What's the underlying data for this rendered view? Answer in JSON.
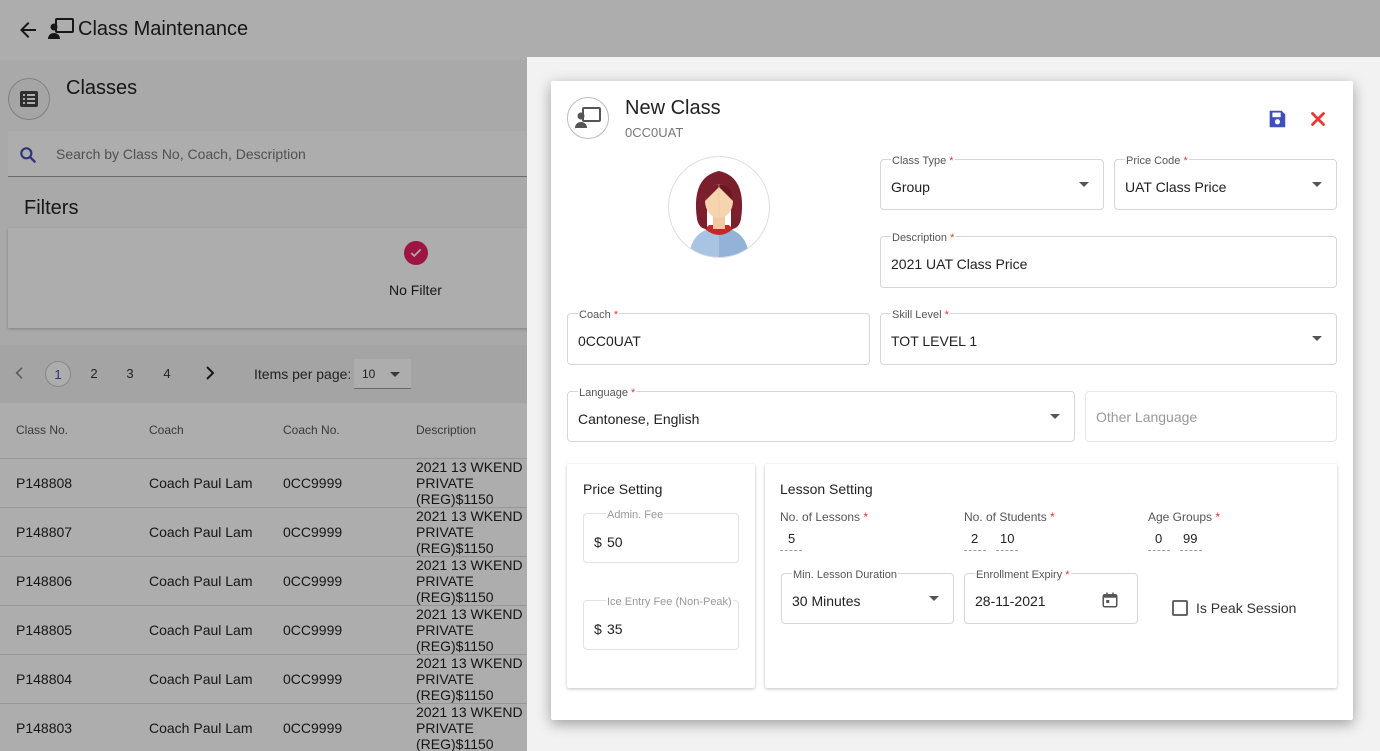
{
  "app": {
    "title": "Class Maintenance"
  },
  "list": {
    "section_title": "Classes",
    "search_placeholder": "Search by Class No, Coach, Description",
    "filters_title": "Filters",
    "filter_option": "No Filter",
    "pages": [
      "1",
      "2",
      "3",
      "4"
    ],
    "active_page": "1",
    "items_per_page_label": "Items per page:",
    "items_per_page": "10",
    "columns": [
      "Class No.",
      "Coach",
      "Coach No.",
      "Description"
    ],
    "rows": [
      {
        "class_no": "P148808",
        "coach": "Coach Paul Lam",
        "coach_no": "0CC9999",
        "desc1": "2021 13 WKEND",
        "desc2": "PRIVATE",
        "desc3": "(REG)$1150"
      },
      {
        "class_no": "P148807",
        "coach": "Coach Paul Lam",
        "coach_no": "0CC9999",
        "desc1": "2021 13 WKEND",
        "desc2": "PRIVATE",
        "desc3": "(REG)$1150"
      },
      {
        "class_no": "P148806",
        "coach": "Coach Paul Lam",
        "coach_no": "0CC9999",
        "desc1": "2021 13 WKEND",
        "desc2": "PRIVATE",
        "desc3": "(REG)$1150"
      },
      {
        "class_no": "P148805",
        "coach": "Coach Paul Lam",
        "coach_no": "0CC9999",
        "desc1": "2021 13 WKEND",
        "desc2": "PRIVATE",
        "desc3": "(REG)$1150"
      },
      {
        "class_no": "P148804",
        "coach": "Coach Paul Lam",
        "coach_no": "0CC9999",
        "desc1": "2021 13 WKEND",
        "desc2": "PRIVATE",
        "desc3": "(REG)$1150"
      },
      {
        "class_no": "P148803",
        "coach": "Coach Paul Lam",
        "coach_no": "0CC9999",
        "desc1": "2021 13 WKEND",
        "desc2": "PRIVATE",
        "desc3": "(REG)$1150"
      }
    ]
  },
  "dialog": {
    "title": "New Class",
    "subtitle": "0CC0UAT",
    "class_type": {
      "label": "Class Type",
      "value": "Group"
    },
    "price_code": {
      "label": "Price Code",
      "value": "UAT Class Price"
    },
    "description": {
      "label": "Description",
      "value": "2021 UAT Class Price"
    },
    "coach": {
      "label": "Coach",
      "value": "0CC0UAT"
    },
    "skill_level": {
      "label": "Skill Level",
      "value": "TOT LEVEL 1"
    },
    "language": {
      "label": "Language",
      "value": "Cantonese, English"
    },
    "other_language": {
      "placeholder": "Other Language"
    },
    "required_mark": "*",
    "price_setting": {
      "title": "Price Setting",
      "currency": "$",
      "admin_fee": {
        "label": "Admin. Fee",
        "value": "50"
      },
      "ice_entry_fee": {
        "label": "Ice Entry Fee (Non-Peak)",
        "value": "35"
      }
    },
    "lesson_setting": {
      "title": "Lesson Setting",
      "no_of_lessons": {
        "label": "No. of Lessons",
        "value": "5"
      },
      "no_of_students": {
        "label": "No. of Students",
        "min": "2",
        "max": "10"
      },
      "age_groups": {
        "label": "Age Groups",
        "min": "0",
        "max": "99"
      },
      "min_lesson_duration": {
        "label": "Min. Lesson Duration",
        "value": "30 Minutes"
      },
      "enrollment_expiry": {
        "label": "Enrollment Expiry",
        "value": "28-11-2021"
      },
      "is_peak_session": {
        "label": "Is Peak Session",
        "checked": false
      }
    }
  },
  "colors": {
    "accent": "#3f51b5",
    "pink": "#e91e63",
    "close": "#e53935"
  }
}
